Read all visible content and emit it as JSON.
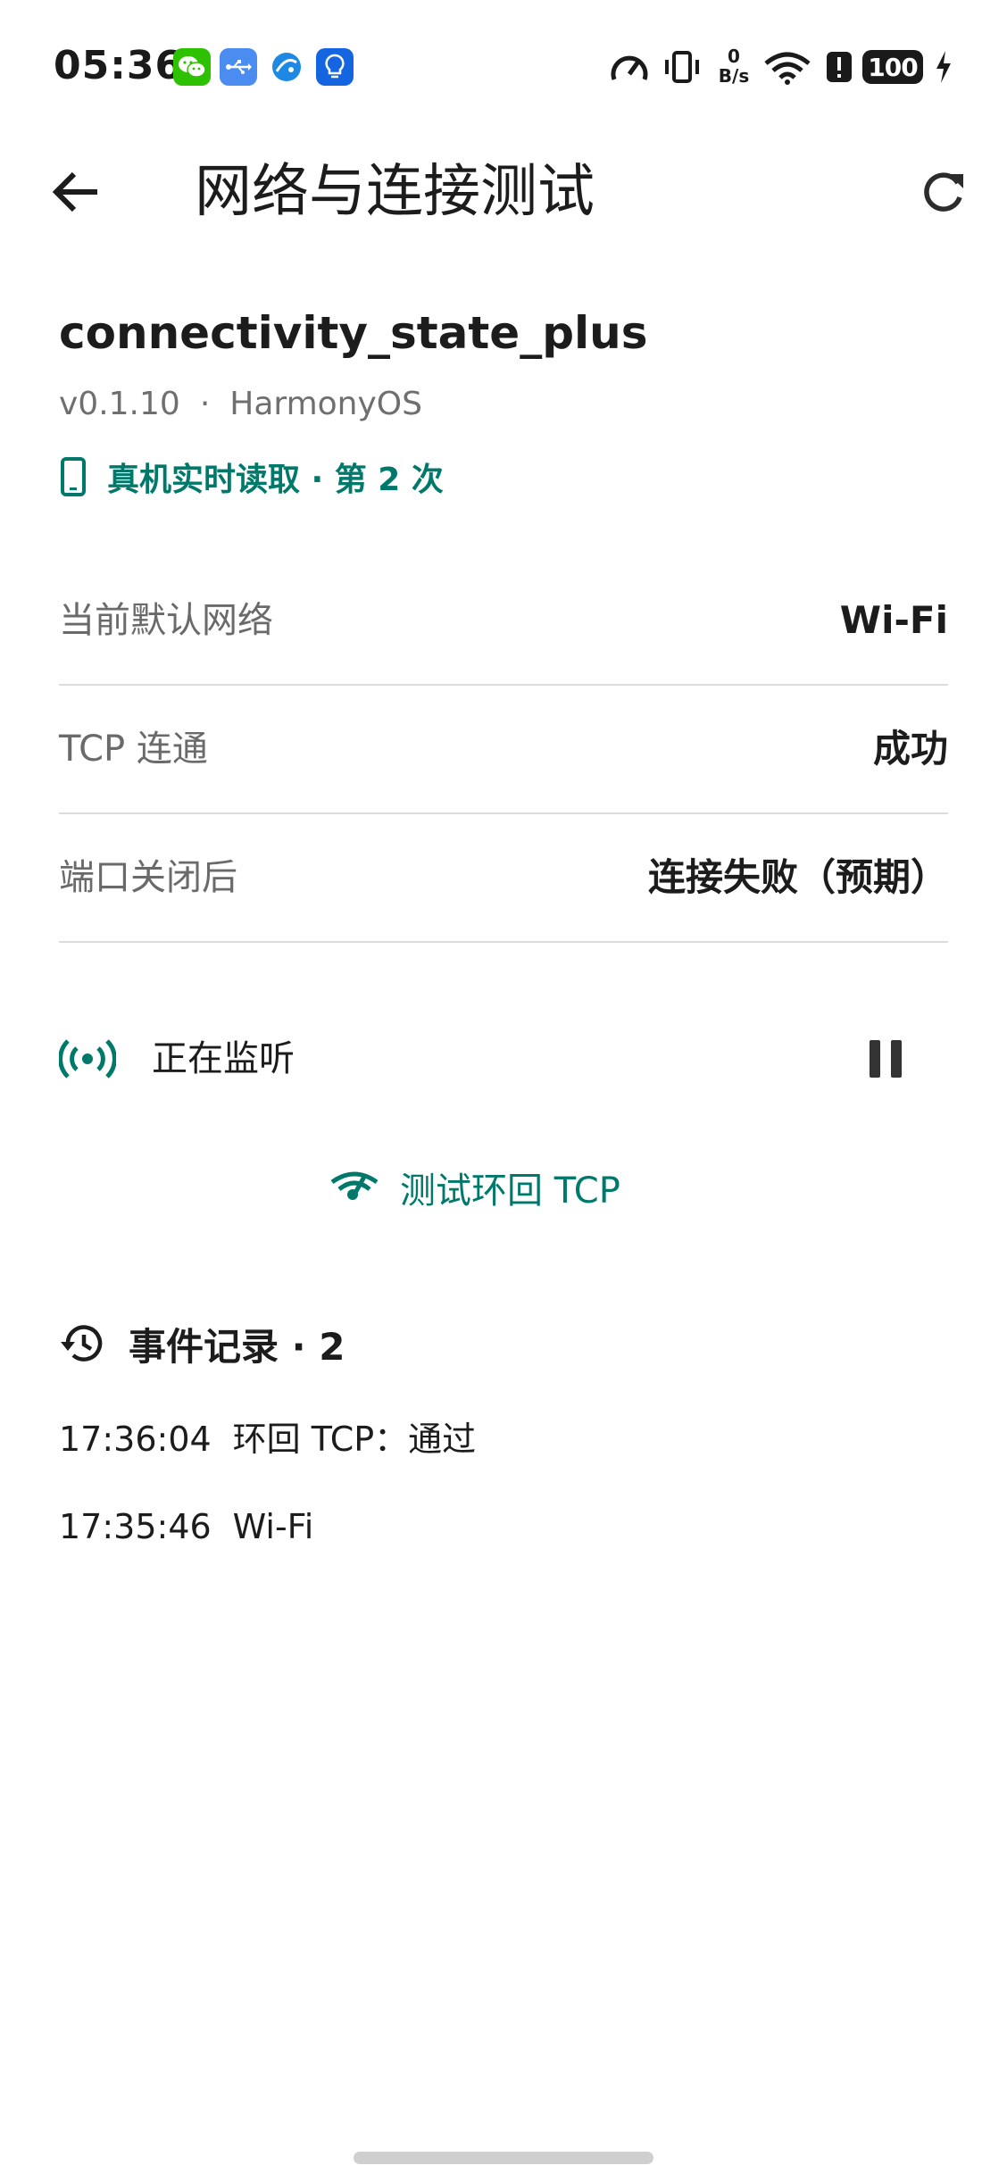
{
  "status_bar": {
    "time": "05:36",
    "notification_icons": [
      "wechat-icon",
      "usb-icon",
      "browser-icon",
      "lightbulb-app-icon"
    ],
    "speed_value": "0",
    "speed_unit": "B/s",
    "battery": "100"
  },
  "app_bar": {
    "title": "网络与连接测试"
  },
  "package": {
    "name": "connectivity_state_plus",
    "version": "v0.1.10",
    "separator": "·",
    "platform": "HarmonyOS",
    "device_read": "真机实时读取 · 第 2 次"
  },
  "rows": [
    {
      "label": "当前默认网络",
      "value": "Wi-Fi"
    },
    {
      "label": "TCP 连通",
      "value": "成功"
    },
    {
      "label": "端口关闭后",
      "value": "连接失败（预期）"
    }
  ],
  "listening": {
    "label": "正在监听"
  },
  "test_button": {
    "label": "测试环回 TCP"
  },
  "events": {
    "header": "事件记录 · 2",
    "items": [
      {
        "time": "17:36:04",
        "text": "环回 TCP：通过"
      },
      {
        "time": "17:35:46",
        "text": "Wi-Fi"
      }
    ]
  },
  "colors": {
    "accent": "#00796b",
    "text": "#1c1c1c",
    "secondary_text": "#6a6a6a",
    "divider": "#dcdcdc"
  }
}
